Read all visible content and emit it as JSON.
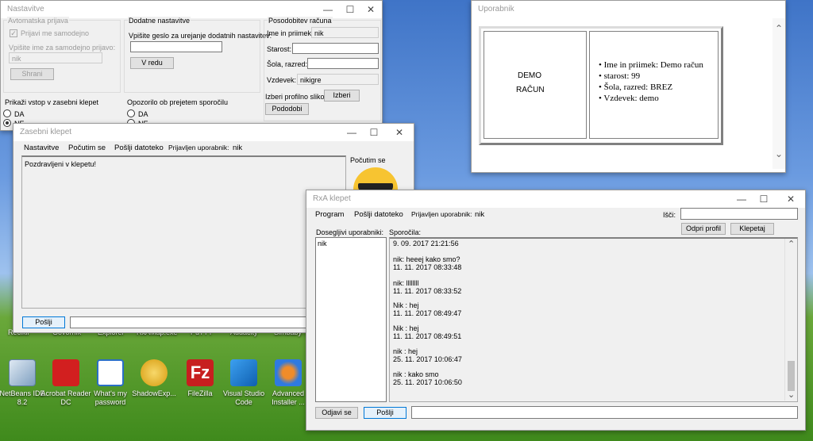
{
  "taskbar_labels": [
    "Recikli",
    "Govornik",
    "Explorer",
    "RxAMap.exe",
    "PuTTY",
    "Audacity",
    "Simbaby"
  ],
  "desktop_icons": [
    {
      "name": "netbeans",
      "label": "NetBeans IDE 8.2",
      "color": "#9fbbd6"
    },
    {
      "name": "acrobat",
      "label": "Acrobat Reader DC",
      "color": "#d21f1f"
    },
    {
      "name": "whats-my-password",
      "label": "What's my password",
      "color": "#ffffff"
    },
    {
      "name": "shadowexplorer",
      "label": "ShadowExp...",
      "color": "#e8b422"
    },
    {
      "name": "filezilla",
      "label": "FileZilla",
      "color": "#c71f1f"
    },
    {
      "name": "visual-studio-code",
      "label": "Visual Studio Code",
      "color": "#1e7acc"
    },
    {
      "name": "advanced-installer",
      "label": "Advanced Installer ...",
      "color": "#2f7ae0"
    }
  ],
  "nastavitve": {
    "title": "Nastavitve",
    "auto": {
      "heading": "Avtomatska prijava",
      "check_label": "Prijavi me samodejno",
      "name_label": "Vpišite ime za samodejno prijavo:",
      "name_value": "nik",
      "save": "Shrani"
    },
    "extra": {
      "heading": "Dodatne nastavitve",
      "pass_label": "Vpišite geslo za urejanje dodatnih nastavitev:",
      "ok": "V redu"
    },
    "account": {
      "heading": "Posodobitev računa",
      "name_label": "Ime in priimek:",
      "name_value": "nik",
      "age_label": "Starost:",
      "school_label": "Šola, razred:",
      "nick_label": "Vzdevek:",
      "nick_value": "nikigre",
      "photo_label": "Izberi profilno sliko:",
      "choose": "Izberi",
      "confirm": "Pododobi"
    },
    "private": {
      "heading": "Prikaži vstop v zasebni klepet",
      "da": "DA",
      "ne": "NE"
    },
    "notify": {
      "heading": "Opozorilo ob prejetem sporočilu",
      "da": "DA",
      "ne": "NE"
    }
  },
  "uporabnik": {
    "title": "Uporabnik",
    "left_line1": "DEMO",
    "left_line2": "RAČUN",
    "items": [
      "Ime in priimek: Demo račun",
      "starost: 99",
      "Šola, razred: BREZ",
      "Vzdevek: demo"
    ]
  },
  "zasebni": {
    "title": "Zasebni klepet",
    "menu": [
      "Nastavitve",
      "Počutim se",
      "Pošlji datoteko",
      "Prijavljen uporabnik:",
      "nik"
    ],
    "message": "Pozdravljeni v klepetu!",
    "feel_label": "Počutim se",
    "send": "Pošlji"
  },
  "rxa": {
    "title": "RxA klepet",
    "menu": [
      "Program",
      "Pošlji datoteko",
      "Prijavljen uporabnik:",
      "nik"
    ],
    "search_label": "Išči:",
    "profile_btn": "Odpri profil",
    "knock_btn": "Klepetaj",
    "users_label": "Dosegljivi uporabniki:",
    "users": [
      "nik"
    ],
    "messages_label": "Sporočila:",
    "messages": [
      "9. 09. 2017 21:21:56",
      "",
      "nik: heeej kako smo?",
      "11. 11. 2017 08:33:48",
      "",
      "nik: llllllll",
      "11. 11. 2017 08:33:52",
      "",
      "Nik : hej",
      "11. 11. 2017 08:49:47",
      "",
      "Nik : hej",
      "11. 11. 2017 08:49:51",
      "",
      "nik : hej",
      "25. 11. 2017 10:06:47",
      "",
      "nik : kako smo",
      "25. 11. 2017 10:06:50"
    ],
    "logout": "Odjavi se",
    "send": "Pošlji"
  },
  "glyphs": {
    "minimize": "—",
    "maximize": "☐",
    "close": "✕",
    "up": "⌃",
    "down": "⌄",
    "check": "✓"
  }
}
